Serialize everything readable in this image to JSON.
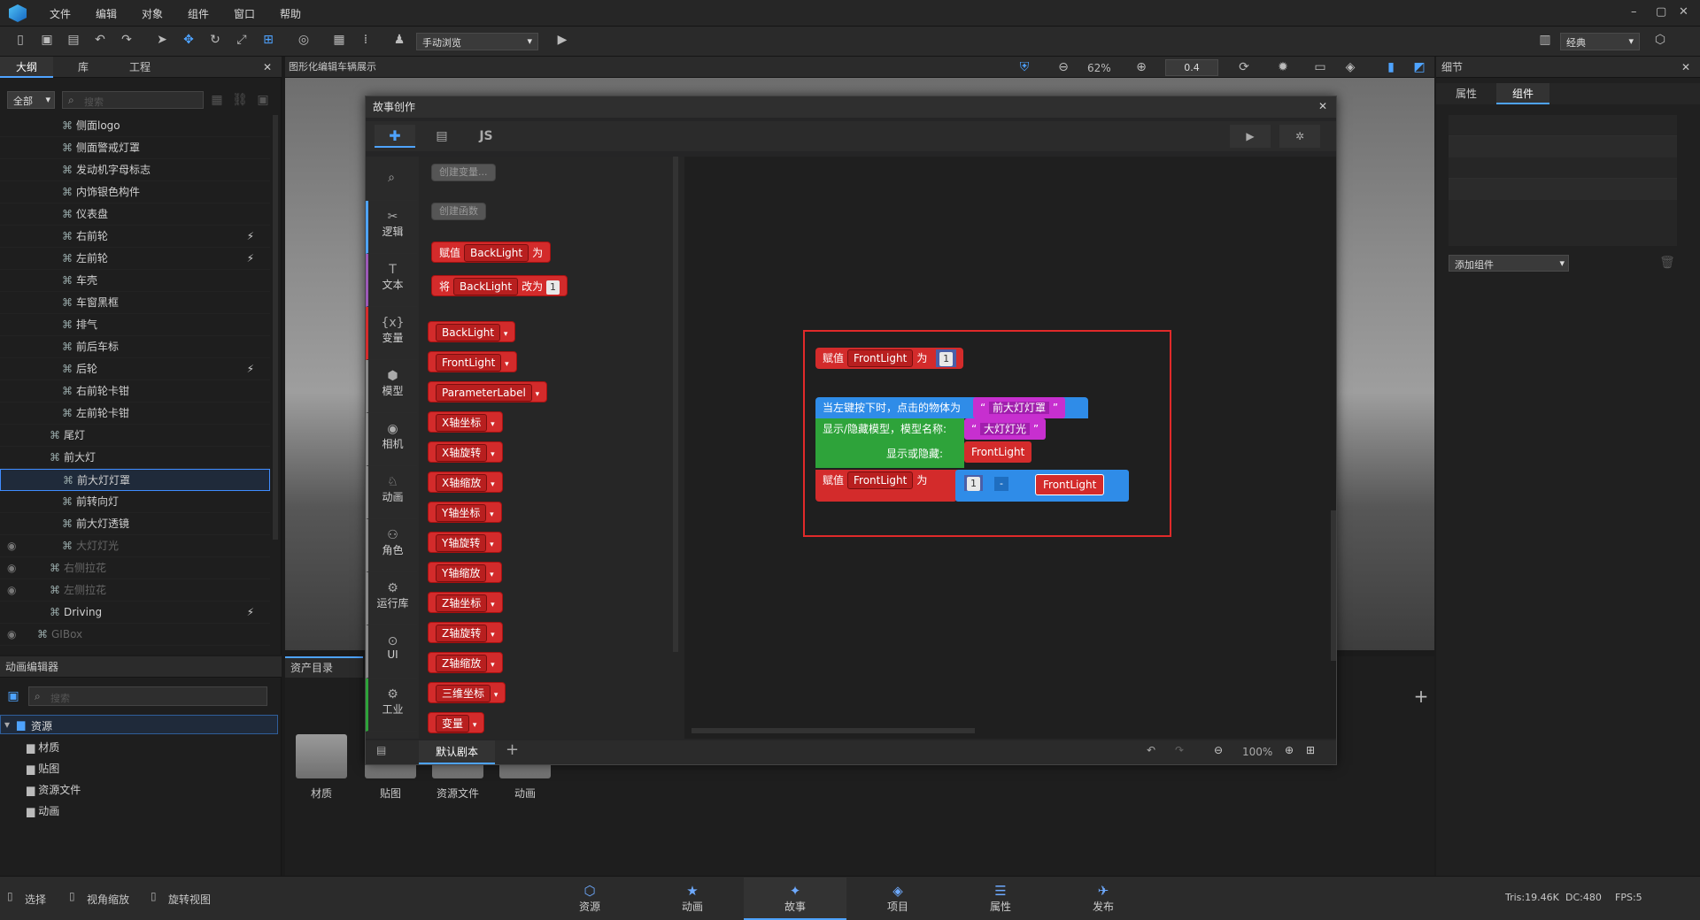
{
  "menubar": {
    "items": [
      "文件",
      "编辑",
      "对象",
      "组件",
      "窗口",
      "帮助"
    ],
    "window_controls": [
      "–",
      "▢",
      "✕"
    ]
  },
  "toolbar": {
    "mode_select": "手动浏览",
    "layout_select": "经典"
  },
  "left_panel": {
    "tabs": [
      "大纲",
      "库",
      "工程"
    ],
    "filter_select": "全部",
    "search_placeholder": "搜索",
    "tree": [
      {
        "label": "侧面logo",
        "depth": 3,
        "dim": false,
        "bolt": false
      },
      {
        "label": "侧面警戒灯罩",
        "depth": 3,
        "dim": false,
        "bolt": false
      },
      {
        "label": "发动机字母标志",
        "depth": 3,
        "dim": false,
        "bolt": false
      },
      {
        "label": "内饰银色构件",
        "depth": 3,
        "dim": false,
        "bolt": false
      },
      {
        "label": "仪表盘",
        "depth": 3,
        "dim": false,
        "bolt": false
      },
      {
        "label": "右前轮",
        "depth": 3,
        "dim": false,
        "bolt": true
      },
      {
        "label": "左前轮",
        "depth": 3,
        "dim": false,
        "bolt": true
      },
      {
        "label": "车壳",
        "depth": 3,
        "dim": false,
        "bolt": false
      },
      {
        "label": "车窗黑框",
        "depth": 3,
        "dim": false,
        "bolt": false
      },
      {
        "label": "排气",
        "depth": 3,
        "dim": false,
        "bolt": false
      },
      {
        "label": "前后车标",
        "depth": 3,
        "dim": false,
        "bolt": false
      },
      {
        "label": "后轮",
        "depth": 3,
        "dim": false,
        "bolt": true
      },
      {
        "label": "右前轮卡钳",
        "depth": 3,
        "dim": false,
        "bolt": false
      },
      {
        "label": "左前轮卡钳",
        "depth": 3,
        "dim": false,
        "bolt": false
      },
      {
        "label": "尾灯",
        "depth": 2,
        "dim": false,
        "bolt": false
      },
      {
        "label": "前大灯",
        "depth": 2,
        "dim": false,
        "bolt": false
      },
      {
        "label": "前大灯灯罩",
        "depth": 3,
        "dim": false,
        "bolt": false,
        "selected": true
      },
      {
        "label": "前转向灯",
        "depth": 3,
        "dim": false,
        "bolt": false
      },
      {
        "label": "前大灯透镜",
        "depth": 3,
        "dim": false,
        "bolt": false
      },
      {
        "label": "大灯灯光",
        "depth": 3,
        "dim": true,
        "bolt": false
      },
      {
        "label": "右侧拉花",
        "depth": 2,
        "dim": true,
        "bolt": false
      },
      {
        "label": "左侧拉花",
        "depth": 2,
        "dim": true,
        "bolt": false
      },
      {
        "label": "Driving",
        "depth": 2,
        "dim": false,
        "bolt": true
      },
      {
        "label": "GIBox",
        "depth": 1,
        "dim": true,
        "bolt": false
      }
    ]
  },
  "anim_panel": {
    "title": "动画编辑器",
    "search_placeholder": "搜索",
    "tree": [
      "资源",
      "材质",
      "贴图",
      "资源文件",
      "动画"
    ]
  },
  "asset_panel": {
    "tab": "资产目录",
    "folders": [
      "材质",
      "贴图",
      "资源文件",
      "动画"
    ]
  },
  "viewport": {
    "title": "图形化编辑车辆展示",
    "zoom": "62%",
    "speed": "0.4"
  },
  "right_panel": {
    "title": "细节",
    "tabs": [
      "属性",
      "组件"
    ],
    "add_component": "添加组件"
  },
  "dialog": {
    "title": "故事创作",
    "js_label": "JS",
    "categories": [
      "逻辑",
      "文本",
      "变量",
      "模型",
      "相机",
      "动画",
      "角色",
      "运行库",
      "UI",
      "工业"
    ],
    "palette": {
      "create_var": "创建变量...",
      "create_func": "创建函数",
      "set_block": {
        "a": "赋值",
        "var": "BackLight",
        "b": "为"
      },
      "change_block": {
        "a": "将",
        "var": "BackLight",
        "b": "改为",
        "num": "1"
      },
      "vars": [
        "BackLight",
        "FrontLight",
        "ParameterLabel",
        "X轴坐标",
        "X轴旋转",
        "X轴缩放",
        "Y轴坐标",
        "Y轴旋转",
        "Y轴缩放",
        "Z轴坐标",
        "Z轴旋转",
        "Z轴缩放",
        "三维坐标",
        "变量"
      ]
    },
    "workspace": {
      "b1": {
        "a": "赋值",
        "var": "FrontLight",
        "b": "为",
        "num": "1"
      },
      "event": {
        "label": "当左键按下时，点击的物体为",
        "text": "前大灯灯罩"
      },
      "show": {
        "label": "显示/隐藏模型，模型名称:",
        "text": "大灯灯光",
        "label2": "显示或隐藏:",
        "var": "FrontLight"
      },
      "b2": {
        "a": "赋值",
        "var": "FrontLight",
        "b": "为",
        "num": "1",
        "op": "-",
        "var2": "FrontLight"
      }
    },
    "script_tab": "默认剧本",
    "zoom": "100%"
  },
  "bottom_tabs": [
    "资源",
    "动画",
    "故事",
    "项目",
    "属性",
    "发布"
  ],
  "status": {
    "select": "选择",
    "zoom_view": "视角缩放",
    "rotate_view": "旋转视图",
    "tris": "Tris:19.46K",
    "dc": "DC:480",
    "fps": "FPS:5"
  }
}
